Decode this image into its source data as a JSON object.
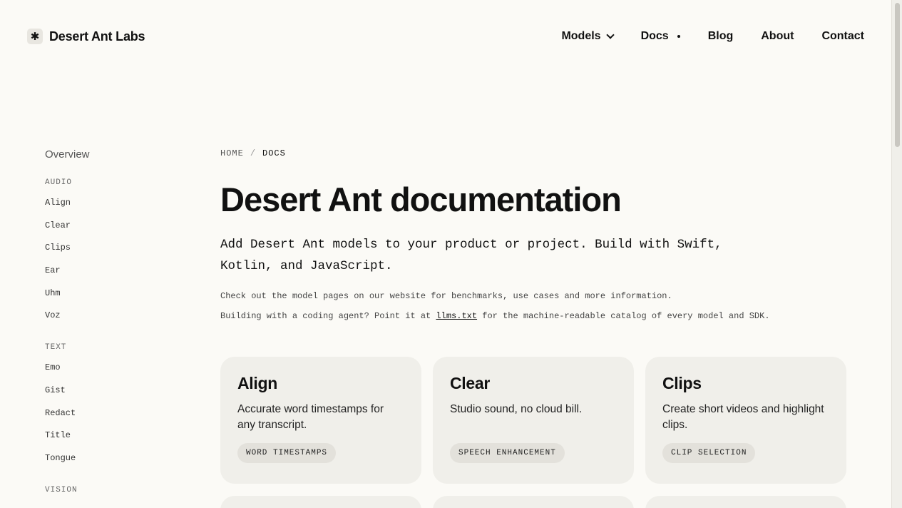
{
  "header": {
    "logo_glyph": "✱",
    "logo_text": "Desert Ant Labs",
    "nav": {
      "models": "Models",
      "docs": "Docs",
      "blog": "Blog",
      "about": "About",
      "contact": "Contact"
    }
  },
  "sidebar": {
    "overview": "Overview",
    "groups": [
      {
        "title": "AUDIO",
        "items": [
          "Align",
          "Clear",
          "Clips",
          "Ear",
          "Uhm",
          "Voz"
        ]
      },
      {
        "title": "TEXT",
        "items": [
          "Emo",
          "Gist",
          "Redact",
          "Title",
          "Tongue"
        ]
      },
      {
        "title": "VISION",
        "items": []
      }
    ]
  },
  "breadcrumb": {
    "home": "HOME",
    "separator": "/",
    "current": "DOCS"
  },
  "main": {
    "title": "Desert Ant documentation",
    "lead": "Add Desert Ant models to your product or project. Build with Swift, Kotlin, and JavaScript.",
    "info1": "Check out the model pages on our website for benchmarks, use cases and more information.",
    "info2_before": "Building with a coding agent? Point it at ",
    "info2_link": "llms.txt",
    "info2_after": " for the machine-readable catalog of every model and SDK."
  },
  "cards": [
    {
      "title": "Align",
      "desc": "Accurate word timestamps for any transcript.",
      "tag": "WORD TIMESTAMPS"
    },
    {
      "title": "Clear",
      "desc": "Studio sound, no cloud bill.",
      "tag": "SPEECH ENHANCEMENT"
    },
    {
      "title": "Clips",
      "desc": "Create short videos and highlight clips.",
      "tag": "CLIP SELECTION"
    }
  ]
}
